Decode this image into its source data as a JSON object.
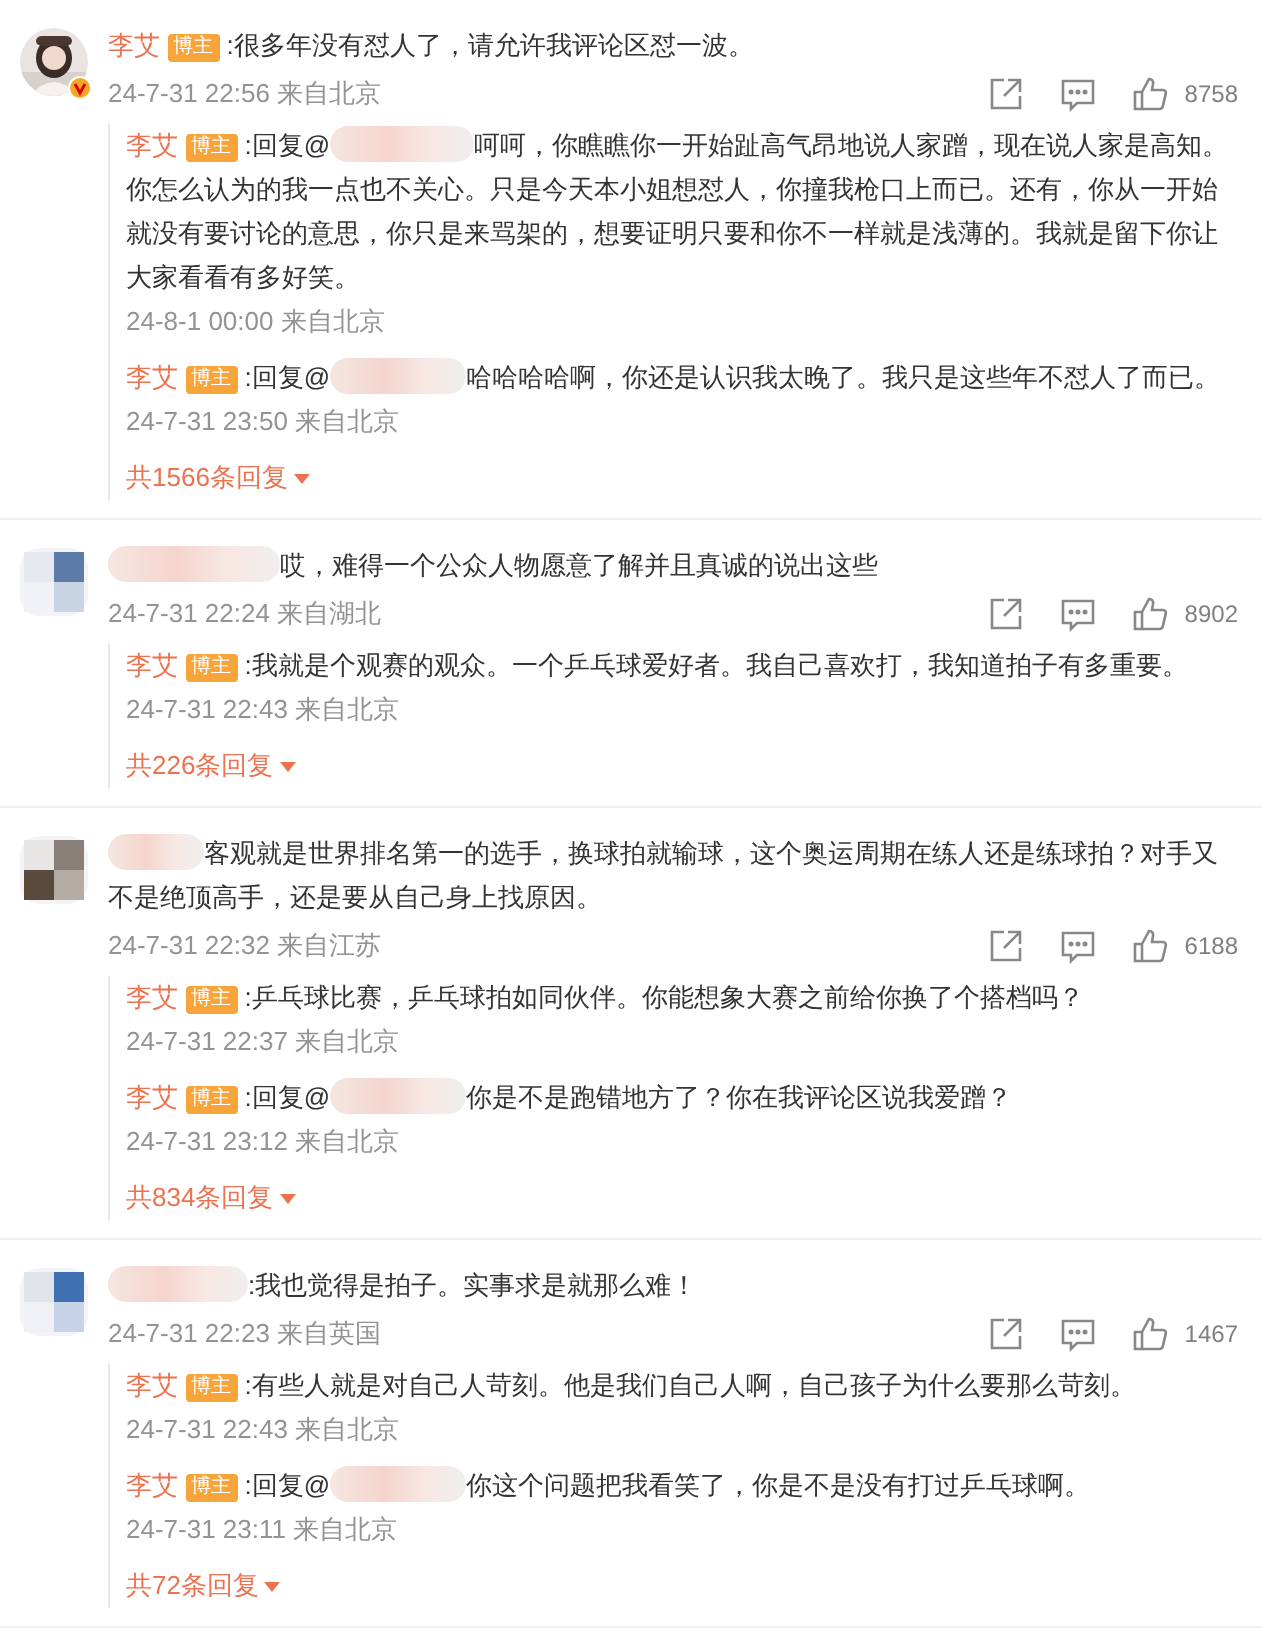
{
  "comments": [
    {
      "kind": "named",
      "author": "李艾",
      "badge": "博主",
      "verified": true,
      "text": ":很多年没有怼人了，请允许我评论区怼一波。",
      "time": "24-7-31 22:56 来自北京",
      "likes": "8758",
      "more": "共1566条回复",
      "replies": [
        {
          "author": "李艾",
          "badge": "博主",
          "prefix": ":回复@",
          "text": "呵呵，你瞧瞧你一开始趾高气昂地说人家蹭，现在说人家是高知。你怎么认为的我一点也不关心。只是今天本小姐想怼人，你撞我枪口上而已。还有，你从一开始就没有要讨论的意思，你只是来骂架的，想要证明只要和你不一样就是浅薄的。我就是留下你让大家看看有多好笑。",
          "time": "24-8-1 00:00 来自北京"
        },
        {
          "author": "李艾",
          "badge": "博主",
          "prefix": ":回复@",
          "text": "哈哈哈哈啊，你还是认识我太晚了。我只是这些年不怼人了而已。",
          "time": "24-7-31 23:50 来自北京"
        }
      ]
    },
    {
      "kind": "masked",
      "verified": false,
      "text": "哎，难得一个公众人物愿意了解并且真诚的说出这些",
      "time": "24-7-31 22:24 来自湖北",
      "likes": "8902",
      "more": "共226条回复",
      "replies": [
        {
          "author": "李艾",
          "badge": "博主",
          "text": ":我就是个观赛的观众。一个乒乓球爱好者。我自己喜欢打，我知道拍子有多重要。",
          "time": "24-7-31 22:43 来自北京"
        }
      ]
    },
    {
      "kind": "masked",
      "verified": false,
      "text": "客观就是世界排名第一的选手，换球拍就输球，这个奥运周期在练人还是练球拍？对手又不是绝顶高手，还是要从自己身上找原因。",
      "time": "24-7-31 22:32 来自江苏",
      "likes": "6188",
      "more": "共834条回复",
      "replies": [
        {
          "author": "李艾",
          "badge": "博主",
          "text": ":乒乓球比赛，乒乓球拍如同伙伴。你能想象大赛之前给你换了个搭档吗？",
          "time": "24-7-31 22:37 来自北京"
        },
        {
          "author": "李艾",
          "badge": "博主",
          "prefix": ":回复@",
          "text": "你是不是跑错地方了？你在我评论区说我爱蹭？",
          "time": "24-7-31 23:12 来自北京"
        }
      ]
    },
    {
      "kind": "masked",
      "verified": false,
      "text": ":我也觉得是拍子。实事求是就那么难！",
      "time": "24-7-31 22:23 来自英国",
      "likes": "1467",
      "more": "共72条回复",
      "replies": [
        {
          "author": "李艾",
          "badge": "博主",
          "text": ":有些人就是对自己人苛刻。他是我们自己人啊，自己孩子为什么要那么苛刻。",
          "time": "24-7-31 22:43 来自北京"
        },
        {
          "author": "李艾",
          "badge": "博主",
          "prefix": ":回复@",
          "text": "你这个问题把我看笑了，你是不是没有打过乒乓球啊。",
          "time": "24-7-31 23:11 来自北京"
        }
      ]
    }
  ]
}
